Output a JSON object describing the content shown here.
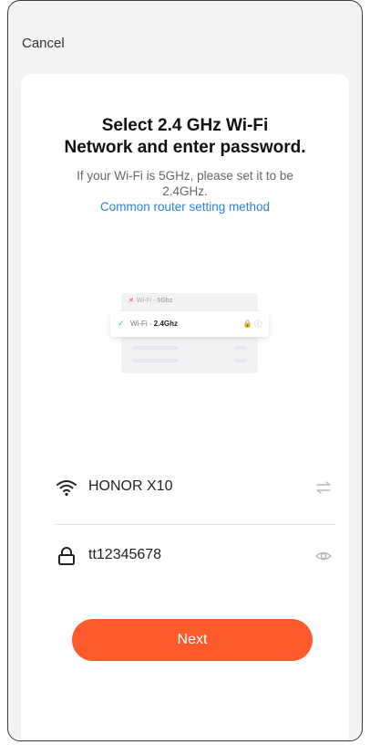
{
  "header": {
    "cancel_label": "Cancel"
  },
  "title": {
    "line1": "Select 2.4 GHz Wi-Fi",
    "line2": "Network and enter password."
  },
  "subtitle": {
    "line1": "If your Wi-Fi is 5GHz, please set it to be",
    "line2_prefix": "2.4GHz.",
    "link": "Common router setting method"
  },
  "illustration": {
    "wifi_5g_prefix": "Wi-Fi - ",
    "wifi_5g_band": "5Ghz",
    "wifi_24_prefix": "Wi-Fi - ",
    "wifi_24_band": "2.4Ghz"
  },
  "wifi": {
    "ssid": "HONOR X10",
    "icon": "wifi-icon",
    "switch_icon": "switch-arrows-icon"
  },
  "password": {
    "value": "tt12345678",
    "icon": "lock-icon",
    "toggle_icon": "eye-icon"
  },
  "actions": {
    "next_label": "Next"
  },
  "colors": {
    "accent": "#ff5a2b",
    "link": "#2c82d8"
  }
}
